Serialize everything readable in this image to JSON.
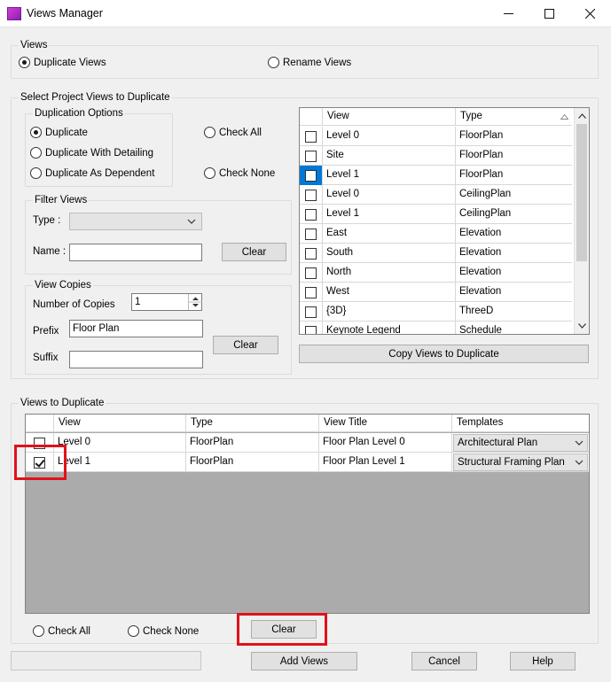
{
  "window": {
    "title": "Views Manager",
    "minimize": "—",
    "maximize": "☐",
    "close": "✕"
  },
  "views_group": {
    "title": "Views",
    "duplicate_views": "Duplicate Views",
    "rename_views": "Rename Views",
    "selected": "duplicate"
  },
  "select_group": {
    "title": "Select Project Views to Duplicate",
    "duplication_options": {
      "title": "Duplication Options",
      "duplicate": "Duplicate",
      "with_detailing": "Duplicate With Detailing",
      "as_dependent": "Duplicate As Dependent",
      "selected": "duplicate"
    },
    "check_all": "Check All",
    "check_none": "Check None",
    "filter_views": {
      "title": "Filter Views",
      "type_label": "Type :",
      "type_value": "",
      "name_label": "Name :",
      "name_value": "",
      "clear": "Clear"
    },
    "view_copies": {
      "title": "View Copies",
      "number_label": "Number of Copies",
      "number_value": "1",
      "prefix_label": "Prefix",
      "prefix_value": "Floor Plan",
      "suffix_label": "Suffix",
      "suffix_value": "",
      "clear": "Clear"
    },
    "views_table": {
      "columns": [
        "View",
        "Type"
      ],
      "rows": [
        {
          "view": "Level 0",
          "type": "FloorPlan",
          "checked": false,
          "selected": false
        },
        {
          "view": "Site",
          "type": "FloorPlan",
          "checked": false,
          "selected": false
        },
        {
          "view": "Level 1",
          "type": "FloorPlan",
          "checked": false,
          "selected": true
        },
        {
          "view": "Level 0",
          "type": "CeilingPlan",
          "checked": false,
          "selected": false
        },
        {
          "view": "Level 1",
          "type": "CeilingPlan",
          "checked": false,
          "selected": false
        },
        {
          "view": "East",
          "type": "Elevation",
          "checked": false,
          "selected": false
        },
        {
          "view": "South",
          "type": "Elevation",
          "checked": false,
          "selected": false
        },
        {
          "view": "North",
          "type": "Elevation",
          "checked": false,
          "selected": false
        },
        {
          "view": "West",
          "type": "Elevation",
          "checked": false,
          "selected": false
        },
        {
          "view": "{3D}",
          "type": "ThreeD",
          "checked": false,
          "selected": false
        },
        {
          "view": "Keynote Legend",
          "type": "Schedule",
          "checked": false,
          "selected": false
        }
      ]
    },
    "copy_button": "Copy Views to Duplicate"
  },
  "duplicate_group": {
    "title": "Views to Duplicate",
    "columns": [
      "View",
      "Type",
      "View Title",
      "Templates"
    ],
    "rows": [
      {
        "view": "Level 0",
        "type": "FloorPlan",
        "title": "Floor Plan Level 0",
        "template": "Architectural Plan",
        "checked": false
      },
      {
        "view": "Level 1",
        "type": "FloorPlan",
        "title": "Floor Plan Level 1",
        "template": "Structural Framing Plan",
        "checked": true
      }
    ],
    "check_all": "Check All",
    "check_none": "Check None",
    "clear": "Clear"
  },
  "footer": {
    "add_views": "Add Views",
    "cancel": "Cancel",
    "help": "Help"
  },
  "colors": {
    "highlight": "#e0121a",
    "selection": "#0078d7",
    "grid_empty": "#ababab"
  }
}
